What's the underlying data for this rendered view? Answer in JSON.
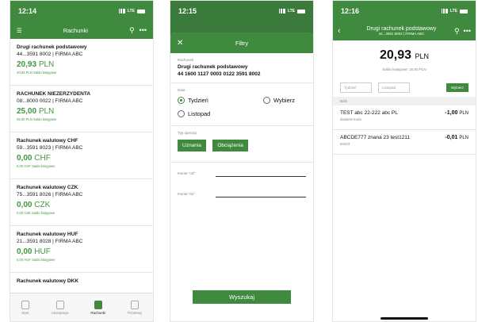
{
  "screen1": {
    "time": "12:14",
    "network": "LTE",
    "title": "Rachunki",
    "accounts": [
      {
        "name": "Drugi rachunek podstawowy",
        "number": "44...3591 8002 | FIRMA ABC",
        "amount": "20,93",
        "currency": "PLN",
        "sub": "20,93 PLN Saldo księgowe"
      },
      {
        "name": "RACHUNEK NIEZERZYDENTA",
        "number": "08...8000 0022 | FIRMA ABC",
        "amount": "25,00",
        "currency": "PLN",
        "sub": "25,00 PLN Saldo księgowe"
      },
      {
        "name": "Rachunek walutowy CHF",
        "number": "59...3591 8023 | FIRMA ABC",
        "amount": "0,00",
        "currency": "CHF",
        "sub": "0,00 CHF Saldo księgowe"
      },
      {
        "name": "Rachunek walutowy CZK",
        "number": "75...3591 8026 | FIRMA ABC",
        "amount": "0,00",
        "currency": "CZK",
        "sub": "0,00 CZK Saldo księgowe"
      },
      {
        "name": "Rachunek walutowy HUF",
        "number": "21...3591 8028 | FIRMA ABC",
        "amount": "0,00",
        "currency": "HUF",
        "sub": "0,00 HUF Saldo księgowe"
      },
      {
        "name": "Rachunek walutowy DKK",
        "number": "",
        "amount": "",
        "currency": "",
        "sub": ""
      }
    ],
    "nav": [
      "Start",
      "Akceptacje",
      "Rachunki",
      "Przelewy"
    ]
  },
  "screen2": {
    "time": "12:15",
    "network": "LTE",
    "title": "Filtry",
    "account_label": "Rachunek",
    "account_name": "Drugi rachunek podstawowy",
    "account_number": "44 1600 1127 0003 0122 3591 8002",
    "date_label": "Data",
    "opt_week": "Tydzień",
    "opt_choose": "Wybierz",
    "opt_nov": "Listopad",
    "op_type_label": "Typ operacji",
    "chip_credit": "Uznania",
    "chip_debit": "Obciążenia",
    "amount_from": "Kwota \"od\"",
    "amount_to": "Kwota \"do\"",
    "search": "Wyszukaj"
  },
  "screen3": {
    "time": "12:16",
    "network": "LTE",
    "title": "Drugi rachunek podstawowy",
    "subtitle": "44...3591 8002 | FIRMA ABC",
    "balance": "20,93",
    "currency": "PLN",
    "balance_sub": "Saldo księgowe: 20,93 PLN",
    "tab_week": "Tydzień",
    "tab_nov": "Listopad",
    "choose": "Wybierz",
    "day": "Dziś",
    "transactions": [
      {
        "name": "TEST abc 22-222 abc PL",
        "sub": "dodanie kodu",
        "amount": "-1,00",
        "currency": "PLN"
      },
      {
        "name": "ABCDE777 znana 23 test1211",
        "sub": "test23",
        "amount": "-0,01",
        "currency": "PLN"
      }
    ]
  }
}
